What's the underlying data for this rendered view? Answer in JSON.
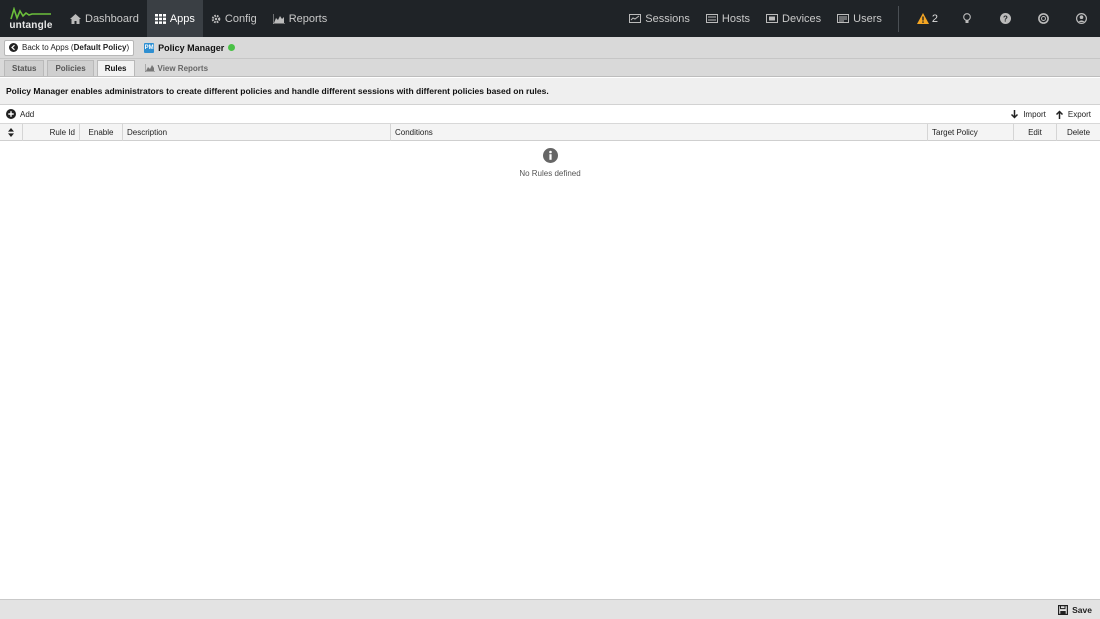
{
  "brand": {
    "logo_text": "untangle"
  },
  "nav": {
    "left": [
      {
        "label": "Dashboard",
        "icon": "home-icon"
      },
      {
        "label": "Apps",
        "icon": "grid-icon",
        "active": true
      },
      {
        "label": "Config",
        "icon": "gear-icon"
      },
      {
        "label": "Reports",
        "icon": "area-chart-icon"
      }
    ],
    "right": [
      {
        "label": "Sessions",
        "icon": "sessions-icon"
      },
      {
        "label": "Hosts",
        "icon": "hosts-icon"
      },
      {
        "label": "Devices",
        "icon": "devices-icon"
      },
      {
        "label": "Users",
        "icon": "users-icon"
      }
    ],
    "alert_count": "2",
    "colors": {
      "background": "#1f2327",
      "active": "#3a3f44",
      "alert": "#f5a623"
    }
  },
  "crumb": {
    "back_prefix": "Back to Apps (",
    "back_policy": "Default Policy",
    "back_suffix": ")",
    "app_name": "Policy Manager",
    "app_icon_text": "PM",
    "status_color": "#49c146"
  },
  "tabs": [
    {
      "label": "Status"
    },
    {
      "label": "Policies"
    },
    {
      "label": "Rules",
      "active": true
    },
    {
      "label": "View Reports",
      "link": true
    }
  ],
  "description": "Policy Manager enables administrators to create different policies and handle different sessions with different policies based on rules.",
  "toolbar": {
    "add": "Add",
    "import": "Import",
    "export": "Export"
  },
  "grid": {
    "columns": [
      "",
      "Rule Id",
      "Enable",
      "Description",
      "Conditions",
      "Target Policy",
      "Edit",
      "Delete"
    ],
    "empty_text": "No Rules defined"
  },
  "footer": {
    "save": "Save"
  }
}
